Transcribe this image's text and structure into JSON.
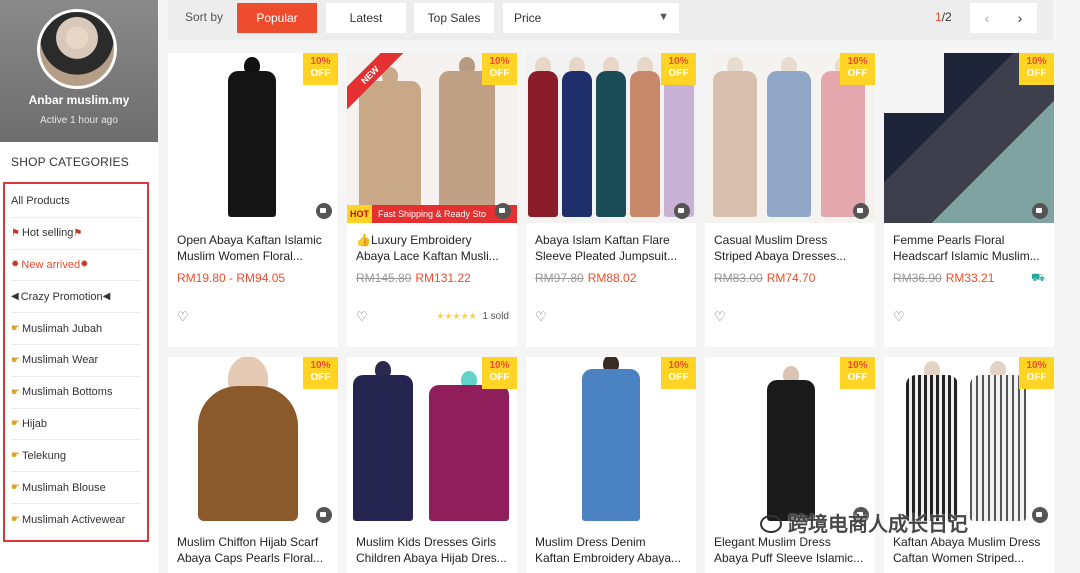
{
  "shop": {
    "name": "Anbar muslim.my",
    "active": "Active 1 hour ago"
  },
  "sidebar": {
    "heading": "SHOP CATEGORIES",
    "items": [
      {
        "label": "All Products",
        "icon": "",
        "icon_after": ""
      },
      {
        "label": "Hot selling",
        "icon": "flag-icon",
        "icon_after": "flag-icon"
      },
      {
        "label": "New arrived",
        "icon": "burst-icon",
        "icon_after": "burst-icon",
        "color": "#ee4d2d"
      },
      {
        "label": "Crazy Promotion",
        "icon": "megaphone-icon",
        "icon_after": "megaphone-icon"
      },
      {
        "label": "Muslimah Jubah",
        "icon": "pointing-hand-icon"
      },
      {
        "label": "Muslimah Wear",
        "icon": "pointing-hand-icon"
      },
      {
        "label": "Muslimah Bottoms",
        "icon": "pointing-hand-icon"
      },
      {
        "label": "Hijab",
        "icon": "pointing-hand-icon"
      },
      {
        "label": "Telekung",
        "icon": "pointing-hand-icon"
      },
      {
        "label": "Muslimah Blouse",
        "icon": "pointing-hand-icon"
      },
      {
        "label": "Muslimah Activewear",
        "icon": "pointing-hand-icon"
      }
    ]
  },
  "sort": {
    "label": "Sort by",
    "options": [
      "Popular",
      "Latest",
      "Top Sales"
    ],
    "active": "Popular",
    "price_label": "Price",
    "page_current": "1",
    "page_total": "/2"
  },
  "colors": {
    "accent": "#ee4d2d",
    "discount_badge": "#ffd424"
  },
  "products": [
    {
      "discount": "10%",
      "off": "OFF",
      "title1": "Open Abaya Kaftan Islamic",
      "title2": "Muslim Women Floral...",
      "price_old": "",
      "price_new": "RM19.80 - RM94.05",
      "rating": "",
      "sold": ""
    },
    {
      "discount": "10%",
      "off": "OFF",
      "title1": "👍Luxury Embroidery",
      "title2": "Abaya Lace Kaftan Musli...",
      "price_old": "RM145.80",
      "price_new": "RM131.22",
      "rating": "★★★★★",
      "sold": "1 sold",
      "ribbon": "NEW",
      "hot": "HOT",
      "ship": "Fast Shipping & Ready Sto"
    },
    {
      "discount": "10%",
      "off": "OFF",
      "title1": "Abaya Islam Kaftan Flare",
      "title2": "Sleeve Pleated Jumpsuit...",
      "price_old": "RM97.80",
      "price_new": "RM88.02",
      "rating": "",
      "sold": ""
    },
    {
      "discount": "10%",
      "off": "OFF",
      "title1": "Casual Muslim Dress",
      "title2": "Striped Abaya Dresses...",
      "price_old": "RM83.00",
      "price_new": "RM74.70",
      "rating": "",
      "sold": ""
    },
    {
      "discount": "10%",
      "off": "OFF",
      "title1": "Femme Pearls Floral",
      "title2": "Headscarf Islamic Muslim...",
      "price_old": "RM36.90",
      "price_new": "RM33.21",
      "rating": "",
      "sold": ""
    },
    {
      "discount": "10%",
      "off": "OFF",
      "title1": "Muslim Chiffon Hijab Scarf",
      "title2": "Abaya Caps Pearls Floral...",
      "price_old": "",
      "price_new": "",
      "rating": "",
      "sold": ""
    },
    {
      "discount": "10%",
      "off": "OFF",
      "title1": "Muslim Kids Dresses Girls",
      "title2": "Children Abaya Hijab Dres...",
      "price_old": "",
      "price_new": "",
      "rating": "",
      "sold": ""
    },
    {
      "discount": "10%",
      "off": "OFF",
      "title1": "Muslim Dress Denim",
      "title2": "Kaftan Embroidery Abaya...",
      "price_old": "",
      "price_new": "",
      "rating": "",
      "sold": ""
    },
    {
      "discount": "10%",
      "off": "OFF",
      "title1": "Elegant Muslim Dress",
      "title2": "Abaya Puff Sleeve Islamic...",
      "price_old": "",
      "price_new": "",
      "rating": "",
      "sold": ""
    },
    {
      "discount": "10%",
      "off": "OFF",
      "title1": "Kaftan Abaya Muslim Dress",
      "title2": "Caftan Women Striped...",
      "price_old": "",
      "price_new": "",
      "rating": "",
      "sold": ""
    }
  ],
  "watermark": "跨境电商人成长日记"
}
